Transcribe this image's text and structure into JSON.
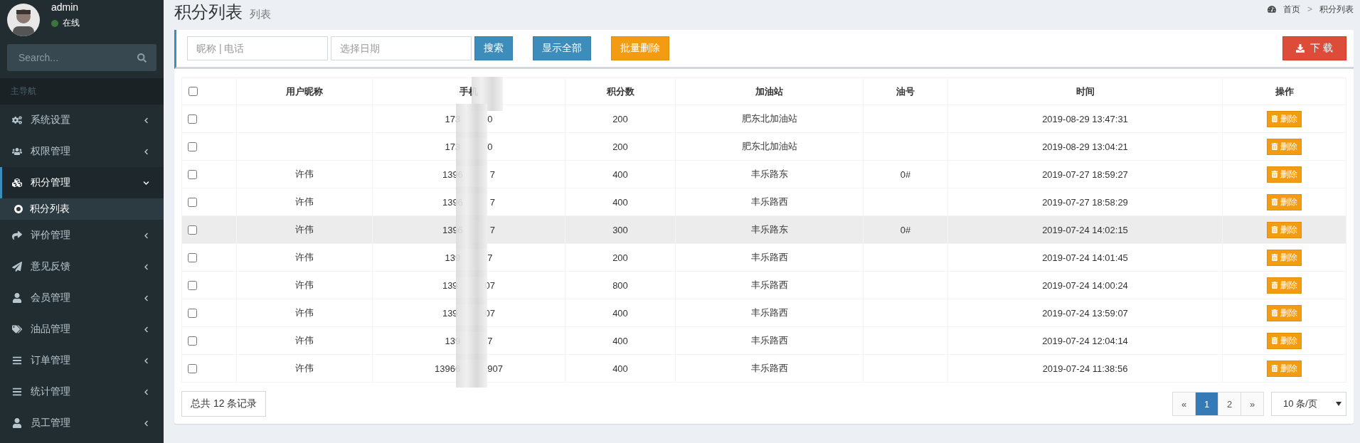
{
  "sidebar": {
    "user": {
      "name": "admin",
      "status": "在线"
    },
    "search": {
      "placeholder": "Search..."
    },
    "section": "主导航",
    "items": [
      {
        "label": "系统设置",
        "expanded": false,
        "selected": false
      },
      {
        "label": "权限管理",
        "expanded": false,
        "selected": false
      },
      {
        "label": "积分管理",
        "expanded": true,
        "selected": true,
        "children": [
          {
            "label": "积分列表",
            "selected": true
          }
        ]
      },
      {
        "label": "评价管理",
        "expanded": false,
        "selected": false
      },
      {
        "label": "意见反馈",
        "expanded": false,
        "selected": false
      },
      {
        "label": "会员管理",
        "expanded": false,
        "selected": false
      },
      {
        "label": "油品管理",
        "expanded": false,
        "selected": false
      },
      {
        "label": "订单管理",
        "expanded": false,
        "selected": false
      },
      {
        "label": "统计管理",
        "expanded": false,
        "selected": false
      },
      {
        "label": "员工管理",
        "expanded": false,
        "selected": false
      }
    ]
  },
  "header": {
    "title": "积分列表",
    "subtitle": "列表",
    "breadcrumb": [
      "首页",
      "积分列表"
    ],
    "breadcrumb_separator": ">"
  },
  "toolbar": {
    "name_field": {
      "placeholder": "昵称 | 电话"
    },
    "date_field": {
      "placeholder": "选择日期"
    },
    "search_button": "搜索",
    "show_all_button": "显示全部",
    "batch_delete_button": "批量删除",
    "download_button": "下 载"
  },
  "table": {
    "columns": [
      "用户昵称",
      "手机",
      "积分数",
      "加油站",
      "油号",
      "时间",
      "操作"
    ],
    "select_all": false,
    "rows": [
      {
        "checked": false,
        "highlighted": false,
        "nickname": "",
        "phone_start": "173",
        "phone_end": "0",
        "points": "200",
        "station": "肥东北加油站",
        "fuel": "",
        "time": "2019-08-29 13:47:31",
        "action": "删除"
      },
      {
        "checked": false,
        "highlighted": false,
        "nickname": "",
        "phone_start": "173",
        "phone_end": "0",
        "points": "200",
        "station": "肥东北加油站",
        "fuel": "",
        "time": "2019-08-29 13:04:21",
        "action": "删除"
      },
      {
        "checked": false,
        "highlighted": false,
        "nickname": "许伟",
        "phone_start": "1396",
        "phone_end": "7",
        "points": "400",
        "station": "丰乐路东",
        "fuel": "0#",
        "time": "2019-07-27 18:59:27",
        "action": "删除"
      },
      {
        "checked": false,
        "highlighted": false,
        "nickname": "许伟",
        "phone_start": "1396",
        "phone_end": "7",
        "points": "400",
        "station": "丰乐路西",
        "fuel": "",
        "time": "2019-07-27 18:58:29",
        "action": "删除"
      },
      {
        "checked": false,
        "highlighted": true,
        "nickname": "许伟",
        "phone_start": "1396",
        "phone_end": "7",
        "points": "300",
        "station": "丰乐路东",
        "fuel": "0#",
        "time": "2019-07-24 14:02:15",
        "action": "删除"
      },
      {
        "checked": false,
        "highlighted": false,
        "nickname": "许伟",
        "phone_start": "139",
        "phone_end": "7",
        "points": "200",
        "station": "丰乐路西",
        "fuel": "",
        "time": "2019-07-24 14:01:45",
        "action": "删除"
      },
      {
        "checked": false,
        "highlighted": false,
        "nickname": "许伟",
        "phone_start": "139",
        "phone_end": "07",
        "points": "800",
        "station": "丰乐路西",
        "fuel": "",
        "time": "2019-07-24 14:00:24",
        "action": "删除"
      },
      {
        "checked": false,
        "highlighted": false,
        "nickname": "许伟",
        "phone_start": "139",
        "phone_end": "07",
        "points": "400",
        "station": "丰乐路西",
        "fuel": "",
        "time": "2019-07-24 13:59:07",
        "action": "删除"
      },
      {
        "checked": false,
        "highlighted": false,
        "nickname": "许伟",
        "phone_start": "139",
        "phone_end": "7",
        "points": "400",
        "station": "丰乐路西",
        "fuel": "",
        "time": "2019-07-24 12:04:14",
        "action": "删除"
      },
      {
        "checked": false,
        "highlighted": false,
        "nickname": "许伟",
        "phone_start": "13966",
        "phone_end": "907",
        "points": "400",
        "station": "丰乐路西",
        "fuel": "",
        "time": "2019-07-24 11:38:56",
        "action": "删除"
      }
    ]
  },
  "footer": {
    "total": "总共 12 条记录",
    "pagination": {
      "prev": "«",
      "pages": [
        {
          "label": "1",
          "selected": true
        },
        {
          "label": "2",
          "selected": false
        }
      ],
      "next": "»"
    },
    "page_size": "10 条/页"
  }
}
